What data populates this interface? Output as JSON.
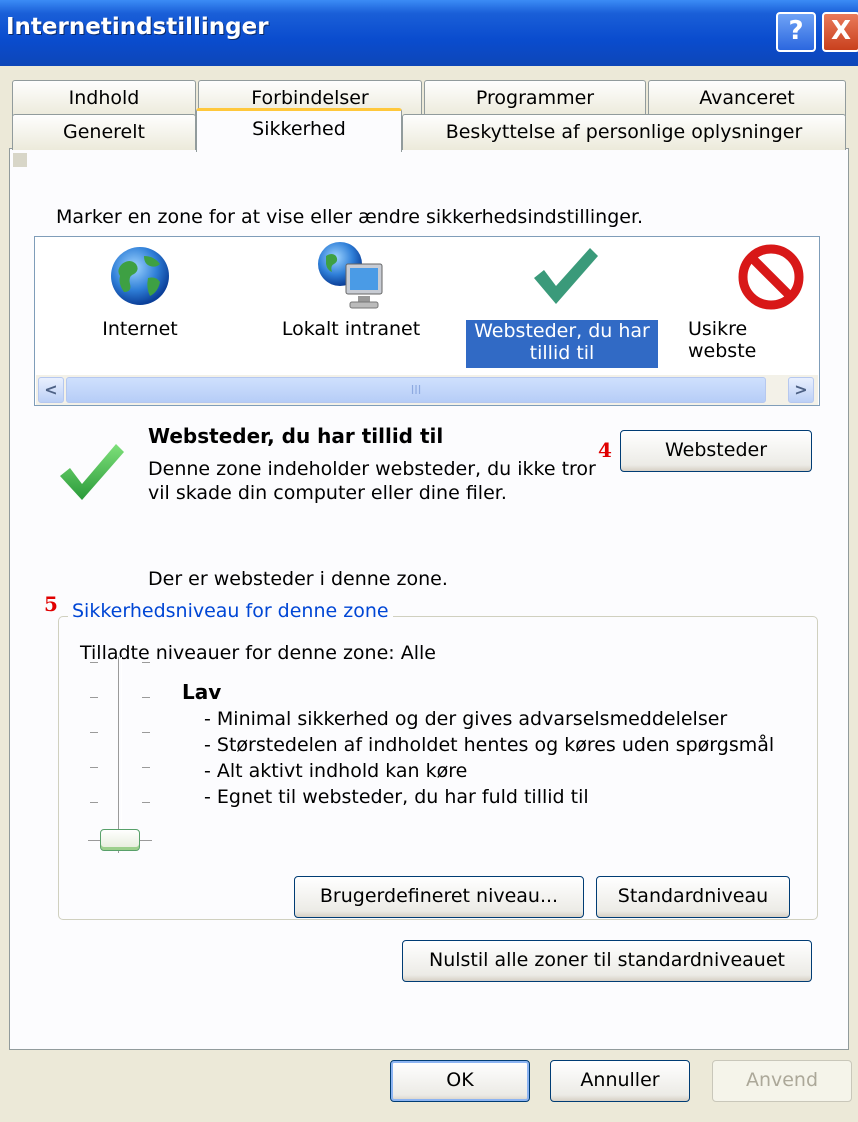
{
  "window": {
    "title": "Internetindstillinger",
    "help_label": "?",
    "close_label": "X"
  },
  "tabs": {
    "row1": [
      "Indhold",
      "Forbindelser",
      "Programmer",
      "Avanceret"
    ],
    "row2": [
      "Generelt",
      "Sikkerhed",
      "Beskyttelse af personlige oplysninger"
    ],
    "active": "Sikkerhed"
  },
  "zones": {
    "instruction": "Marker en zone for at vise eller ændre sikkerhedsindstillinger.",
    "items": [
      {
        "label": "Internet",
        "icon": "globe-icon"
      },
      {
        "label": "Lokalt intranet",
        "icon": "intranet-computer-icon"
      },
      {
        "label_line1": "Websteder, du har",
        "label_line2": "tillid til",
        "icon": "checkmark-icon",
        "selected": true
      },
      {
        "label": "Usikre webste",
        "icon": "restricted-icon"
      }
    ],
    "scroll_left": "<",
    "scroll_right": ">",
    "scroll_grip": "III"
  },
  "zone_info": {
    "title": "Websteder, du har tillid til",
    "desc_line1": "Denne zone indeholder websteder, du ikke tror",
    "desc_line2": "vil skade din computer eller dine filer.",
    "sites_button": "Websteder",
    "sites_note": "Der er websteder i denne zone."
  },
  "markers": {
    "m4": "4",
    "m5": "5"
  },
  "security_level": {
    "group_title": "Sikkerhedsniveau for denne zone",
    "allowed": "Tilladte niveauer for denne zone: Alle",
    "level_name": "Lav",
    "bullets": [
      "- Minimal sikkerhed og der gives advarselsmeddelelser",
      "- Størstedelen af indholdet hentes og køres uden spørgsmål",
      "- Alt aktivt indhold kan køre",
      "- Egnet til websteder, du har fuld tillid til"
    ],
    "slider_level": "Lav",
    "custom_button": "Brugerdefineret niveau...",
    "default_button": "Standardniveau"
  },
  "reset_button": "Nulstil alle zoner til standardniveauet",
  "footer": {
    "ok": "OK",
    "cancel": "Annuller",
    "apply": "Anvend"
  },
  "colors": {
    "titlebar": "#0a4cce",
    "selection": "#316ac5",
    "group_title": "#0046d5",
    "marker": "#e00000"
  }
}
